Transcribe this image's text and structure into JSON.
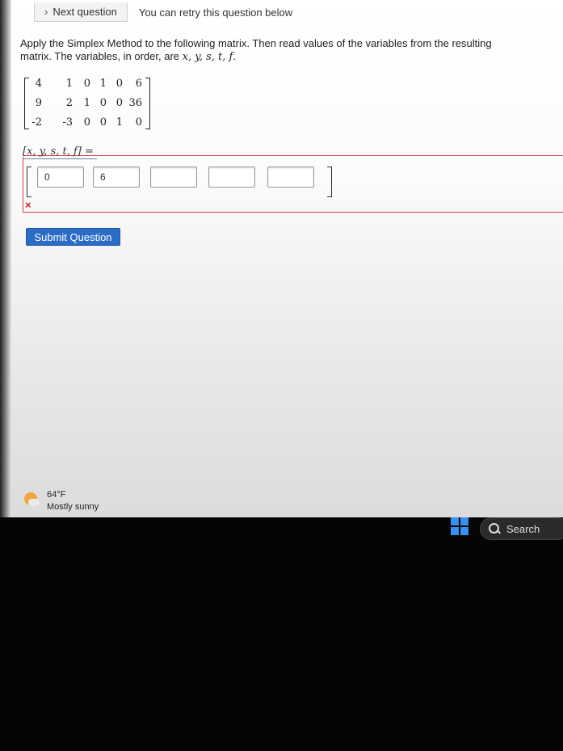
{
  "nav": {
    "next_question_label": "Next question",
    "retry_text": "You can retry this question below"
  },
  "question": {
    "line1": "Apply the Simplex Method to the following matrix. Then read values of the variables from the resulting",
    "line2_prefix": "matrix. The variables, in order, are",
    "variables": "x, y, s, t, f",
    "line2_suffix": "."
  },
  "matrix": {
    "rows": [
      [
        "4",
        "1",
        "0",
        "1",
        "0",
        "6"
      ],
      [
        "9",
        "2",
        "1",
        "0",
        "0",
        "36"
      ],
      [
        "-2",
        "-3",
        "0",
        "0",
        "1",
        "0"
      ]
    ]
  },
  "answer": {
    "label": "[x, y, s, t, f] =",
    "inputs": [
      "0",
      "6",
      "",
      "",
      ""
    ],
    "wrong_mark": "×"
  },
  "submit_label": "Submit Question",
  "taskbar": {
    "temperature": "64°F",
    "condition": "Mostly sunny",
    "search_label": "Search"
  },
  "colors": {
    "submit_bg": "#2b6cc4",
    "error_red": "#cc4444",
    "start_blue": "#3a8ff0"
  }
}
